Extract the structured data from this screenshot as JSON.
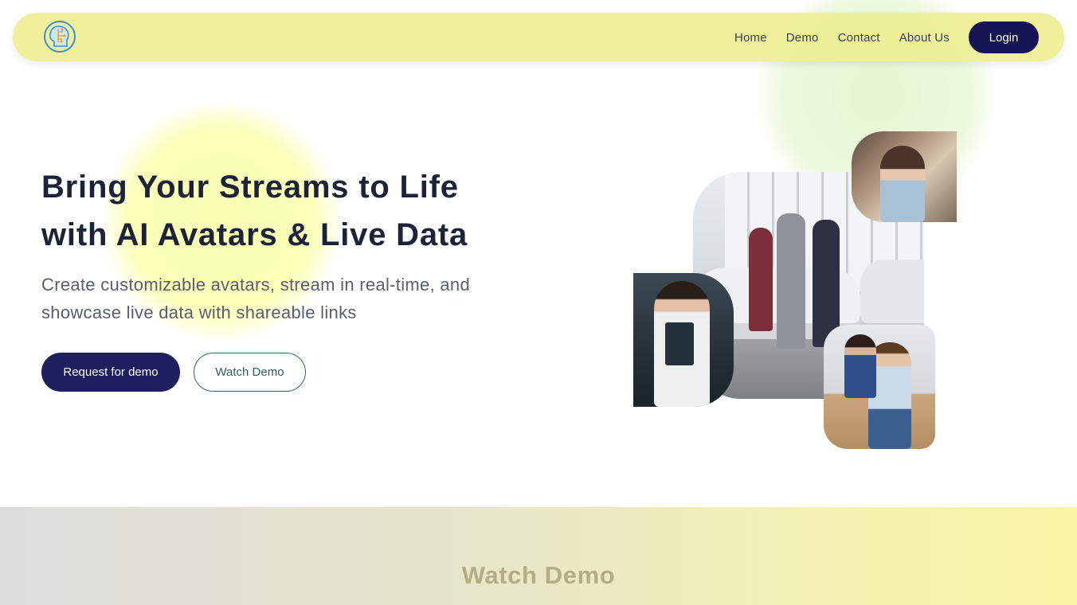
{
  "nav": {
    "logo_icon": "brain-head-icon",
    "links": [
      "Home",
      "Demo",
      "Contact",
      "About Us"
    ],
    "login_label": "Login"
  },
  "hero": {
    "title_line1": "Bring Your Streams to Life",
    "title_line2": "with AI Avatars & Live Data",
    "subtitle": "Create customizable avatars, stream in real-time, and showcase live data with shareable links",
    "primary_button": "Request for demo",
    "secondary_button": "Watch Demo"
  },
  "collage": {
    "images": [
      "car-showroom-handshake-photo",
      "woman-in-car-photo",
      "woman-with-clipboard-photo",
      "couple-with-tablet-photo"
    ]
  },
  "demo_section": {
    "title": "Watch Demo"
  },
  "colors": {
    "navbar_bg": "#eeee91",
    "primary_dark": "#141552",
    "outline_button": "#2b6b6e",
    "title_text": "#1e2238"
  }
}
